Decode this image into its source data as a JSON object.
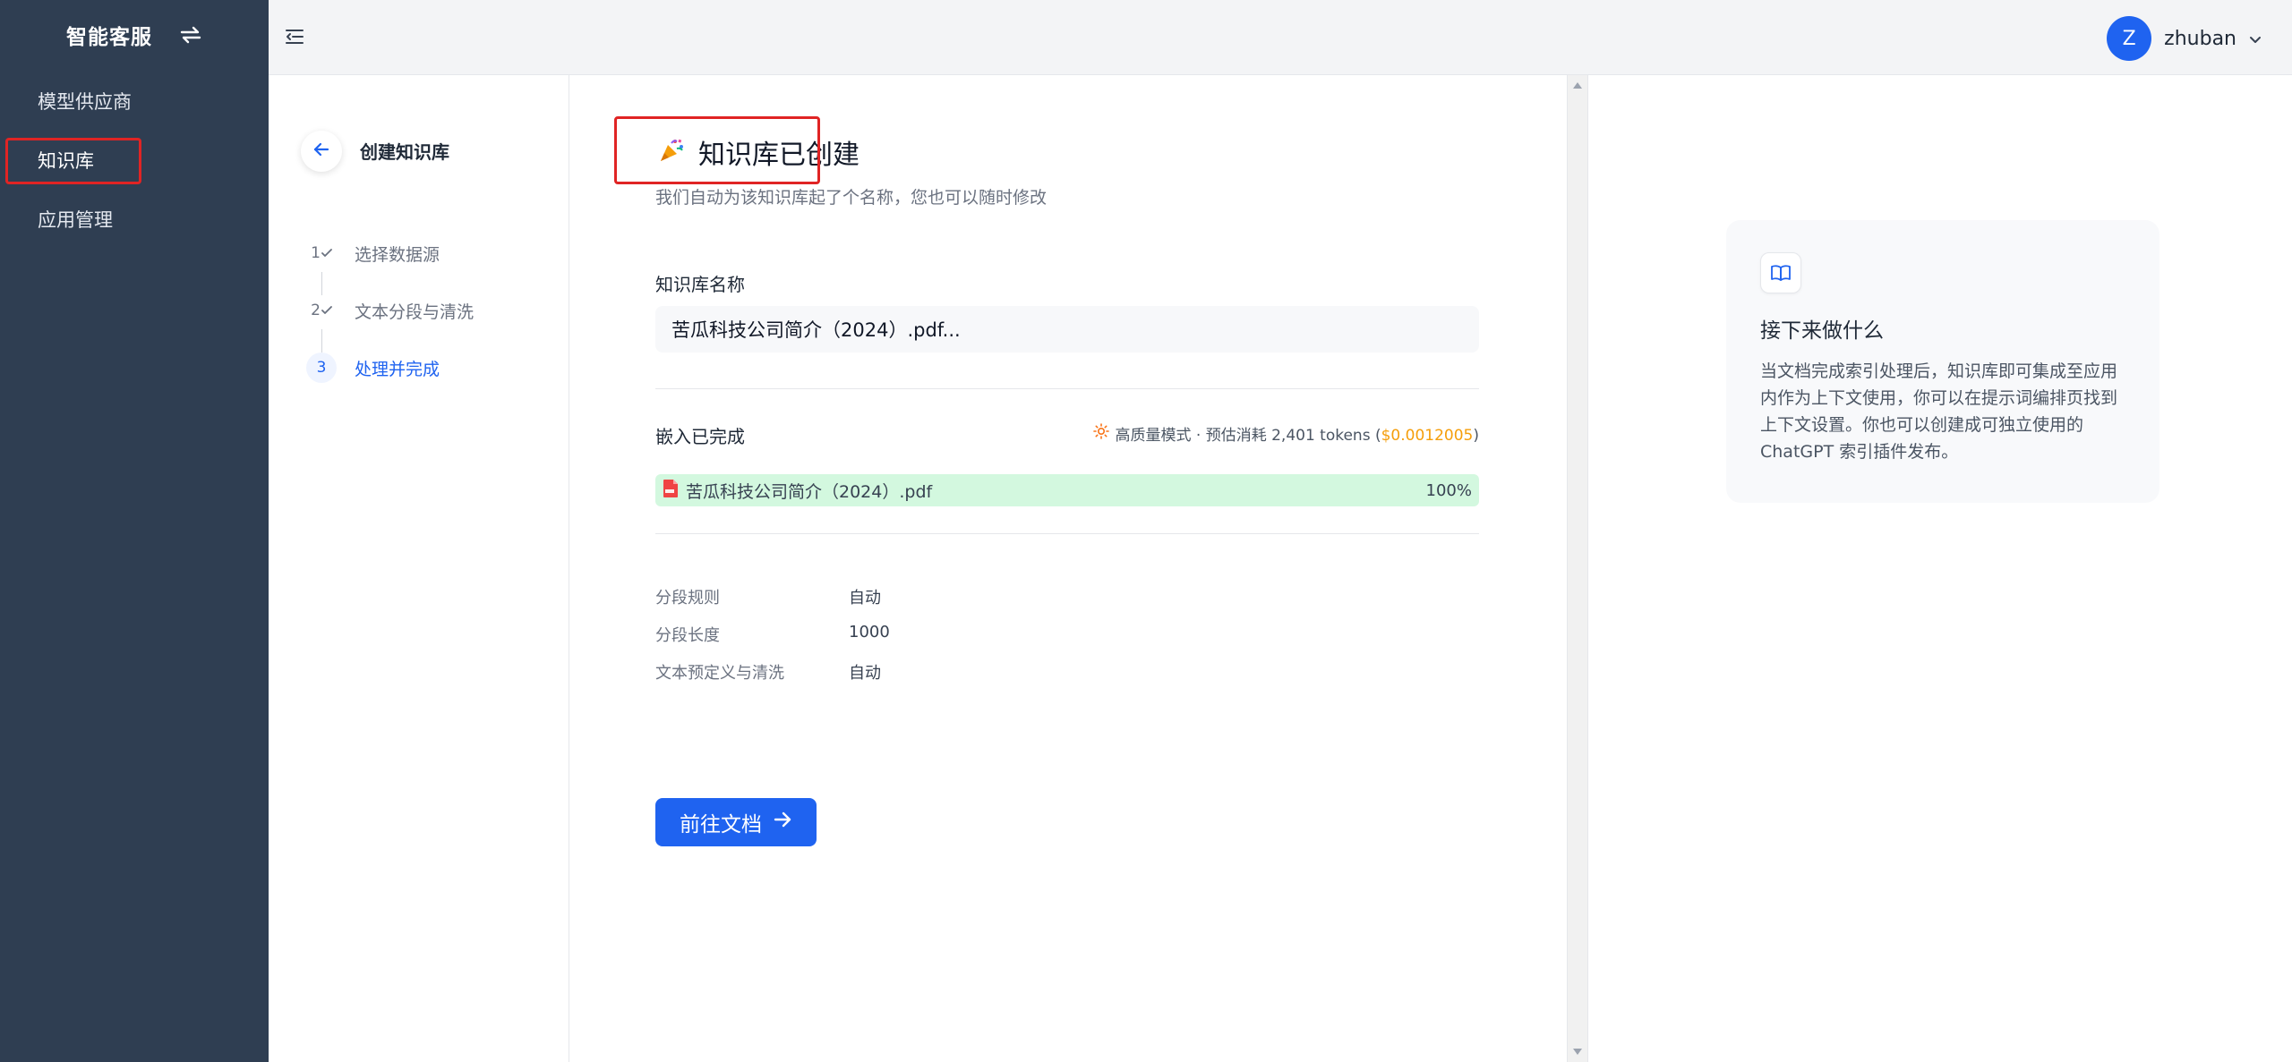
{
  "sidebar": {
    "brand": "智能客服",
    "items": [
      {
        "label": "模型供应商"
      },
      {
        "label": "知识库"
      },
      {
        "label": "应用管理"
      }
    ]
  },
  "topbar": {
    "avatar_letter": "Z",
    "username": "zhuban"
  },
  "steps": {
    "title": "创建知识库",
    "items": [
      {
        "num": "1",
        "label": "选择数据源",
        "state": "done"
      },
      {
        "num": "2",
        "label": "文本分段与清洗",
        "state": "done"
      },
      {
        "num": "3",
        "label": "处理并完成",
        "state": "active"
      }
    ]
  },
  "main": {
    "heading": "知识库已创建",
    "subtext": "我们自动为该知识库起了个名称，您也可以随时修改",
    "name_label": "知识库名称",
    "name_value": "苦瓜科技公司简介（2024）.pdf...",
    "embed_title": "嵌入已完成",
    "embed_mode": "高质量模式 · 预估消耗 2,401 tokens (",
    "embed_price": "$0.0012005",
    "embed_close": ")",
    "file_name": "苦瓜科技公司简介（2024）.pdf",
    "file_progress": "100%",
    "rules": [
      {
        "key": "分段规则",
        "value": "自动"
      },
      {
        "key": "分段长度",
        "value": "1000"
      },
      {
        "key": "文本预定义与清洗",
        "value": "自动"
      }
    ],
    "go_button": "前往文档"
  },
  "info": {
    "title": "接下来做什么",
    "description": "当文档完成索引处理后，知识库即可集成至应用内作为上下文使用，你可以在提示词编排页找到上下文设置。你也可以创建成可独立使用的 ChatGPT 索引插件发布。"
  },
  "colors": {
    "sidebar_bg": "#2f3e52",
    "accent": "#1f63f0",
    "success_bg": "#d3f8df",
    "price": "#f59e0b",
    "highlight_box": "#e02424"
  }
}
